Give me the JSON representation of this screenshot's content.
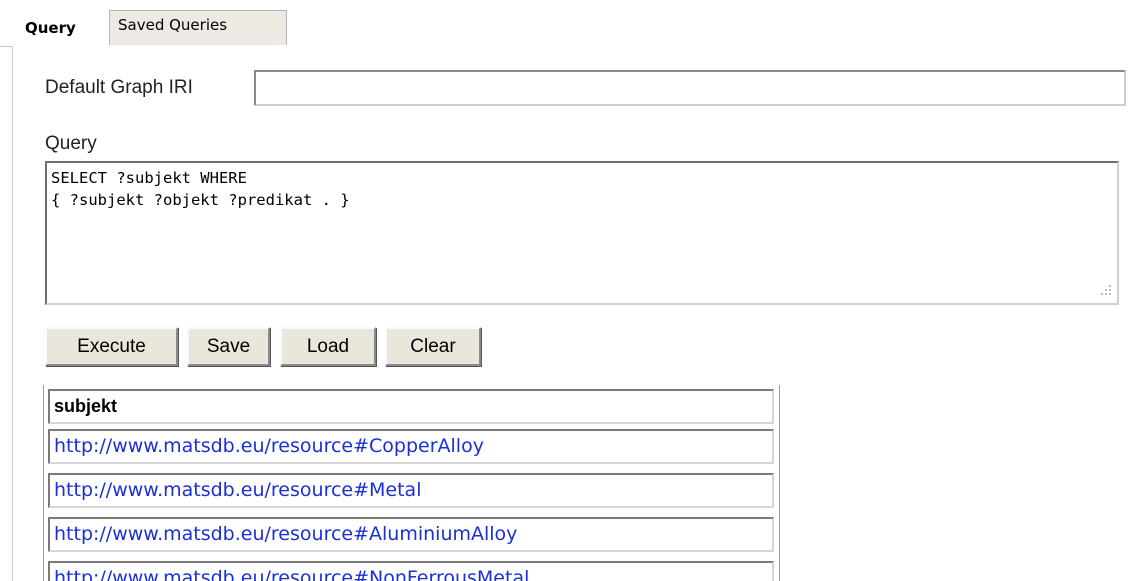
{
  "tabs": [
    {
      "label": "Query",
      "active": true
    },
    {
      "label": "Saved Queries",
      "active": false
    }
  ],
  "form": {
    "default_graph_label": "Default Graph IRI",
    "default_graph_value": "",
    "query_label": "Query",
    "query_text": "SELECT ?subjekt WHERE\n{ ?subjekt ?objekt ?predikat . }"
  },
  "buttons": {
    "execute": "Execute",
    "save": "Save",
    "load": "Load",
    "clear": "Clear"
  },
  "results": {
    "columns": [
      "subjekt"
    ],
    "rows": [
      "http://www.matsdb.eu/resource#CopperAlloy",
      "http://www.matsdb.eu/resource#Metal",
      "http://www.matsdb.eu/resource#AluminiumAlloy",
      "http://www.matsdb.eu/resource#NonFerrousMetal"
    ]
  },
  "colors": {
    "link": "#1a2fd6",
    "button_face": "#e9e6dc",
    "inactive_tab": "#eceae3"
  }
}
